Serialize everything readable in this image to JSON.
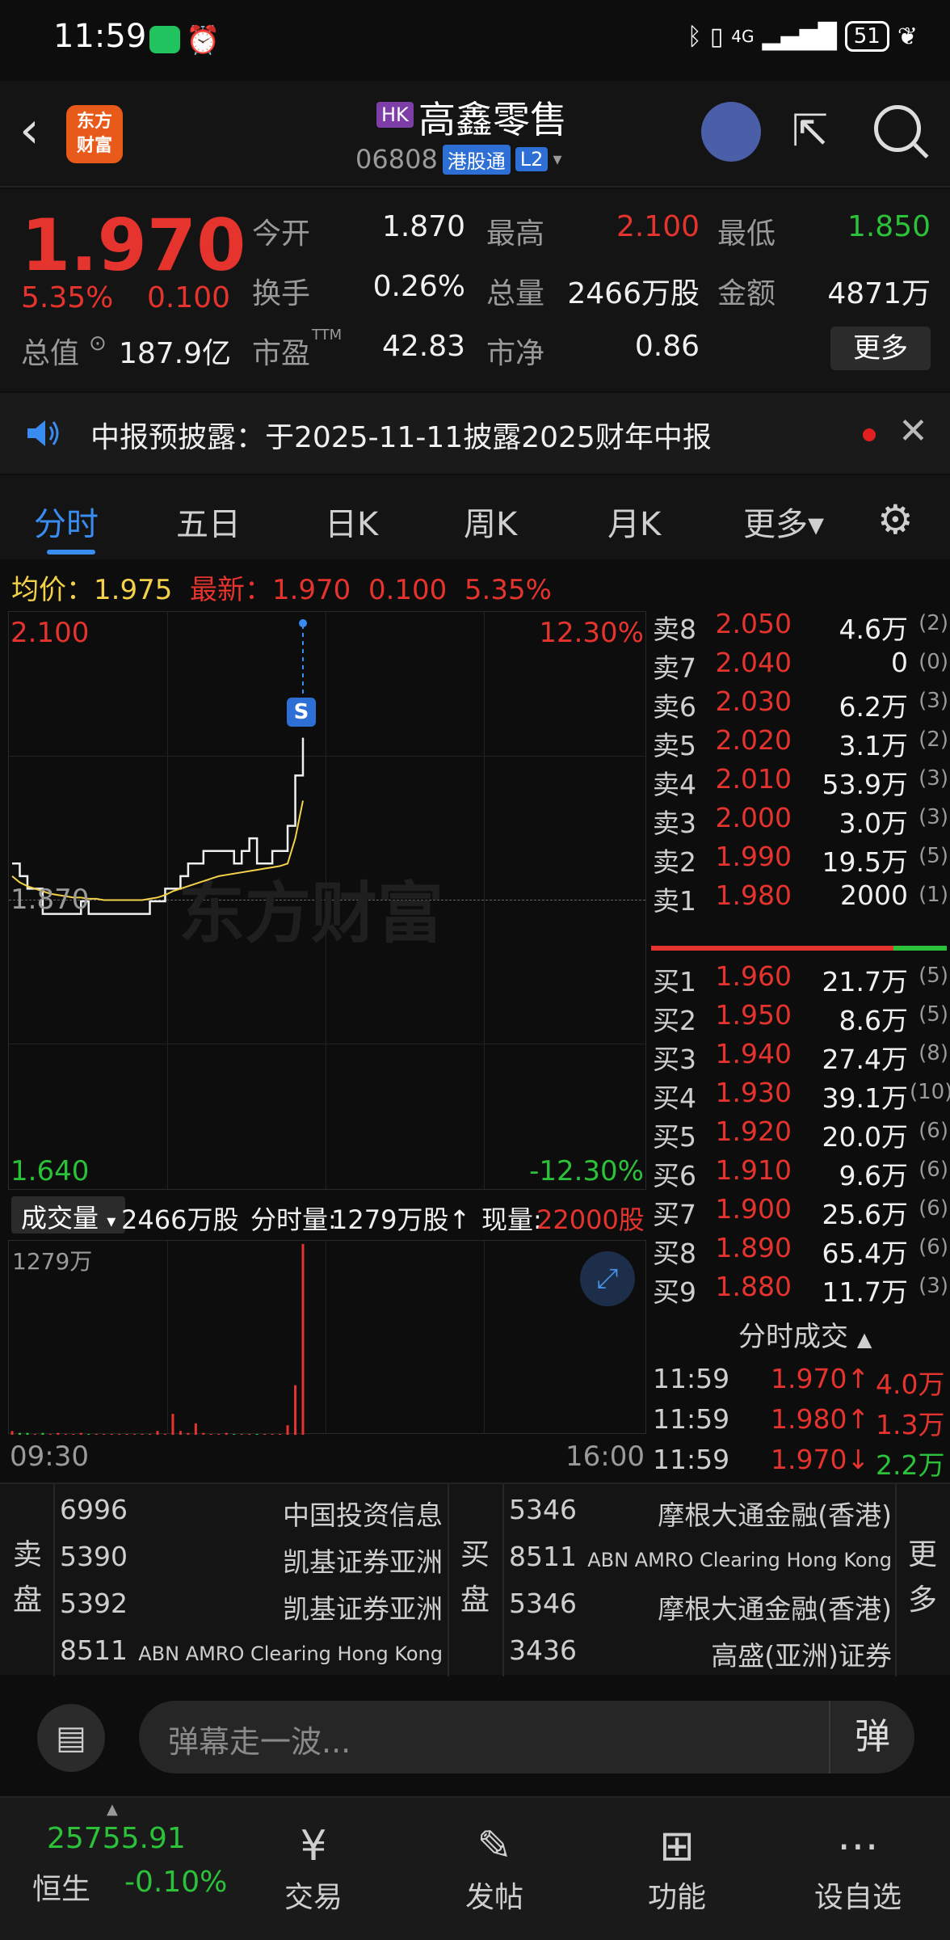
{
  "status": {
    "time": "11:59",
    "network": "4G",
    "battery": "51"
  },
  "header": {
    "market_badge": "HK",
    "stock_name": "高鑫零售",
    "stock_code": "06808",
    "connect_tag": "港股通",
    "level_tag": "L2",
    "logo_line1": "东方",
    "logo_line2": "财富"
  },
  "quote": {
    "price": "1.970",
    "change_pct": "5.35%",
    "change": "0.100",
    "open_label": "今开",
    "open": "1.870",
    "high_label": "最高",
    "high": "2.100",
    "low_label": "最低",
    "low": "1.850",
    "turnover_label": "换手",
    "turnover": "0.26%",
    "volume_label": "总量",
    "volume": "2466万股",
    "amount_label": "金额",
    "amount": "4871万",
    "mktcap_label": "总值",
    "mktcap": "187.9亿",
    "pe_label": "市盈",
    "pe_sup": "TTM",
    "pe": "42.83",
    "pb_label": "市净",
    "pb": "0.86",
    "more": "更多"
  },
  "notice": {
    "text": "中报预披露：于2025-11-11披露2025财年中报"
  },
  "tabs": [
    "分时",
    "五日",
    "日K",
    "周K",
    "月K",
    "更多▾"
  ],
  "avg_line": {
    "avg_label": "均价：",
    "avg": "1.975",
    "latest_label": "最新：",
    "latest": "1.970",
    "change": "0.100",
    "pct": "5.35%"
  },
  "chart": {
    "top_price": "2.100",
    "top_pct": "12.30%",
    "mid_price": "1.870",
    "bottom_price": "1.640",
    "bottom_pct": "-12.30%",
    "watermark": "东方财富",
    "marker": "S"
  },
  "chart_data": {
    "type": "line",
    "ylim": [
      1.64,
      2.1
    ],
    "reference": 1.87,
    "series": [
      {
        "name": "price",
        "color": "#f0f0f0",
        "values": [
          1.9,
          1.89,
          1.88,
          1.88,
          1.86,
          1.86,
          1.86,
          1.86,
          1.86,
          1.87,
          1.86,
          1.86,
          1.86,
          1.86,
          1.86,
          1.86,
          1.86,
          1.86,
          1.87,
          1.87,
          1.88,
          1.88,
          1.89,
          1.9,
          1.9,
          1.91,
          1.91,
          1.91,
          1.91,
          1.9,
          1.91,
          1.92,
          1.9,
          1.9,
          1.91,
          1.91,
          1.93,
          1.97,
          2.0
        ]
      },
      {
        "name": "avg",
        "color": "#f3d24a",
        "values": [
          1.89,
          1.885,
          1.882,
          1.88,
          1.878,
          1.876,
          1.875,
          1.874,
          1.873,
          1.873,
          1.872,
          1.872,
          1.871,
          1.871,
          1.871,
          1.871,
          1.871,
          1.871,
          1.872,
          1.873,
          1.875,
          1.878,
          1.88,
          1.882,
          1.884,
          1.886,
          1.888,
          1.89,
          1.891,
          1.892,
          1.893,
          1.894,
          1.895,
          1.896,
          1.897,
          1.898,
          1.9,
          1.92,
          1.95
        ]
      }
    ],
    "volume": [
      0.02,
      0.01,
      0.01,
      0.0,
      0.01,
      0.0,
      0.01,
      0.0,
      0.0,
      0.01,
      0.0,
      0.0,
      0.0,
      0.0,
      0.0,
      0.0,
      0.0,
      0.0,
      0.0,
      0.02,
      0.0,
      0.11,
      0.02,
      0.01,
      0.06,
      0.01,
      0.0,
      0.0,
      0.01,
      0.0,
      0.0,
      0.0,
      0.0,
      0.0,
      0.0,
      0.0,
      0.05,
      0.26,
      1.0
    ]
  },
  "volume_row": {
    "select": "成交量",
    "total": "2466万股",
    "tick_label": "分时量:",
    "tick": "1279万股↑",
    "now_label": "现量:",
    "now": "22000股",
    "vol_max": "1279万"
  },
  "time_axis": {
    "start": "09:30",
    "end": "16:00"
  },
  "order_book": {
    "asks": [
      {
        "label": "卖8",
        "price": "2.050",
        "vol": "4.6万",
        "n": "(2)"
      },
      {
        "label": "卖7",
        "price": "2.040",
        "vol": "0",
        "n": "(0)"
      },
      {
        "label": "卖6",
        "price": "2.030",
        "vol": "6.2万",
        "n": "(3)"
      },
      {
        "label": "卖5",
        "price": "2.020",
        "vol": "3.1万",
        "n": "(2)"
      },
      {
        "label": "卖4",
        "price": "2.010",
        "vol": "53.9万",
        "n": "(3)"
      },
      {
        "label": "卖3",
        "price": "2.000",
        "vol": "3.0万",
        "n": "(3)"
      },
      {
        "label": "卖2",
        "price": "1.990",
        "vol": "19.5万",
        "n": "(5)"
      },
      {
        "label": "卖1",
        "price": "1.980",
        "vol": "2000",
        "n": "(1)"
      }
    ],
    "bids": [
      {
        "label": "买1",
        "price": "1.960",
        "vol": "21.7万",
        "n": "(5)"
      },
      {
        "label": "买2",
        "price": "1.950",
        "vol": "8.6万",
        "n": "(5)"
      },
      {
        "label": "买3",
        "price": "1.940",
        "vol": "27.4万",
        "n": "(8)"
      },
      {
        "label": "买4",
        "price": "1.930",
        "vol": "39.1万",
        "n": "(10)"
      },
      {
        "label": "买5",
        "price": "1.920",
        "vol": "20.0万",
        "n": "(6)"
      },
      {
        "label": "买6",
        "price": "1.910",
        "vol": "9.6万",
        "n": "(6)"
      },
      {
        "label": "买7",
        "price": "1.900",
        "vol": "25.6万",
        "n": "(6)"
      },
      {
        "label": "买8",
        "price": "1.890",
        "vol": "65.4万",
        "n": "(6)"
      },
      {
        "label": "买9",
        "price": "1.880",
        "vol": "11.7万",
        "n": "(3)"
      }
    ]
  },
  "trades": {
    "title": "分时成交",
    "rows": [
      {
        "time": "11:59",
        "price": "1.970↑",
        "vol": "4.0万"
      },
      {
        "time": "11:59",
        "price": "1.980↑",
        "vol": "1.3万"
      },
      {
        "time": "11:59",
        "price": "1.970↓",
        "vol": "2.2万"
      }
    ]
  },
  "broker_queue": {
    "sell_label_1": "卖",
    "sell_label_2": "盘",
    "buy_label_1": "买",
    "buy_label_2": "盘",
    "more_label_1": "更",
    "more_label_2": "多",
    "sell": [
      {
        "id": "6996",
        "name": "中国投资信息"
      },
      {
        "id": "5390",
        "name": "凯基证券亚洲"
      },
      {
        "id": "5392",
        "name": "凯基证券亚洲"
      },
      {
        "id": "8511",
        "name": "ABN AMRO Clearing Hong Kong"
      }
    ],
    "buy": [
      {
        "id": "5346",
        "name": "摩根大通金融(香港)"
      },
      {
        "id": "8511",
        "name": "ABN AMRO Clearing Hong Kong"
      },
      {
        "id": "5346",
        "name": "摩根大通金融(香港)"
      },
      {
        "id": "3436",
        "name": "高盛(亚洲)证券"
      }
    ]
  },
  "comment": {
    "placeholder": "弹幕走一波...",
    "send": "弹"
  },
  "bottom_nav": {
    "index_value": "25755.91",
    "index_name": "恒生",
    "index_change": "-0.10%",
    "items": [
      "交易",
      "发帖",
      "功能",
      "设自选"
    ]
  }
}
